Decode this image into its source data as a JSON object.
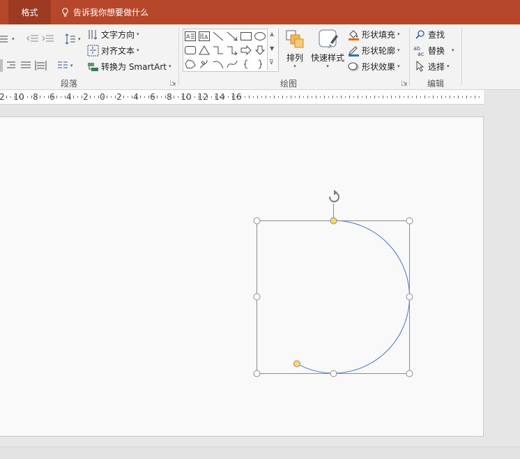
{
  "titlebar": {
    "active_tab": "格式",
    "tell_me": "告诉我你想要做什么"
  },
  "ribbon": {
    "paragraph": {
      "label": "段落",
      "text_direction": "文字方向",
      "align_text": "对齐文本",
      "convert_smartart": "转换为 SmartArt"
    },
    "drawing": {
      "label": "绘图",
      "arrange": "排列",
      "quick_styles": "快速样式",
      "shape_fill": "形状填充",
      "shape_outline": "形状轮廓",
      "shape_effects": "形状效果"
    },
    "editing": {
      "label": "编辑",
      "find": "查找",
      "replace": "替换",
      "select": "选择"
    }
  },
  "ruler": {
    "labels": [
      "2",
      "10",
      "8",
      "6",
      "4",
      "2",
      "0",
      "2",
      "4",
      "6",
      "8",
      "10",
      "12",
      "14",
      "16"
    ]
  },
  "colors": {
    "accent": "#b7472a",
    "shape_stroke": "#4472c4",
    "handle_yellow": "#ffd966"
  }
}
